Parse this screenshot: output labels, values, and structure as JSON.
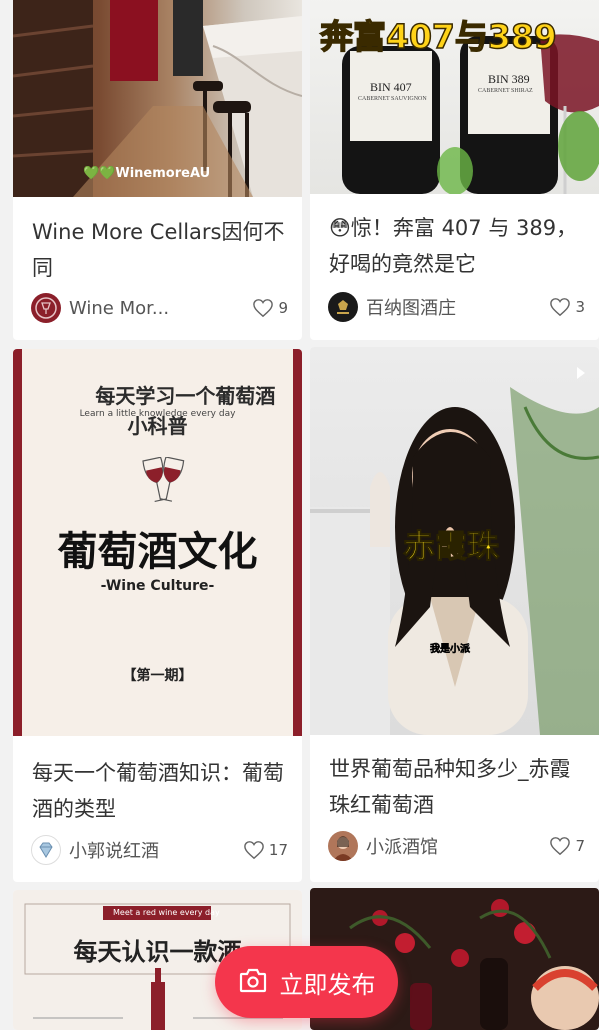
{
  "cards": [
    {
      "title": "Wine More Cellars因何不同",
      "overlay": "💚💚WinemoreAU",
      "author": "Wine Mor...",
      "likes": "9",
      "avatar_icon": "wine-glass-icon"
    },
    {
      "title": "😳惊！奔富 407 与 389，好喝的竟然是它",
      "overlay_title": "奔富407与389",
      "label_left_top": "BIN 407",
      "label_left_sub": "CABERNET SAUVIGNON",
      "label_right_top": "BIN 389",
      "label_right_sub": "CABERNET SHIRAZ",
      "author": "百纳图酒庄",
      "likes": "3",
      "avatar_icon": "logo-icon"
    },
    {
      "title": "每天一个葡萄酒知识：葡萄酒的类型",
      "poster_heading": "每天学习一个葡萄酒\n小科普",
      "poster_sub": "Learn a little knowledge every day",
      "poster_main": "葡萄酒文化",
      "poster_en": "-Wine Culture-",
      "poster_issue": "【第一期】",
      "author": "小郭说红酒",
      "likes": "17",
      "avatar_icon": "diamond-icon"
    },
    {
      "title": "世界葡萄品种知多少_赤霞珠红葡萄酒",
      "overlay_caption": "赤霞珠",
      "overlay_subtitle": "我是小派",
      "author": "小派酒馆",
      "likes": "7",
      "avatar_icon": "person-icon"
    },
    {
      "banner_small": "Meet a red wine every day",
      "banner_main": "每天认识一款酒"
    },
    {}
  ],
  "fab": {
    "label": "立即发布",
    "icon": "camera-icon"
  },
  "colors": {
    "accent": "#f4364c",
    "wine": "#8c1f2a"
  }
}
